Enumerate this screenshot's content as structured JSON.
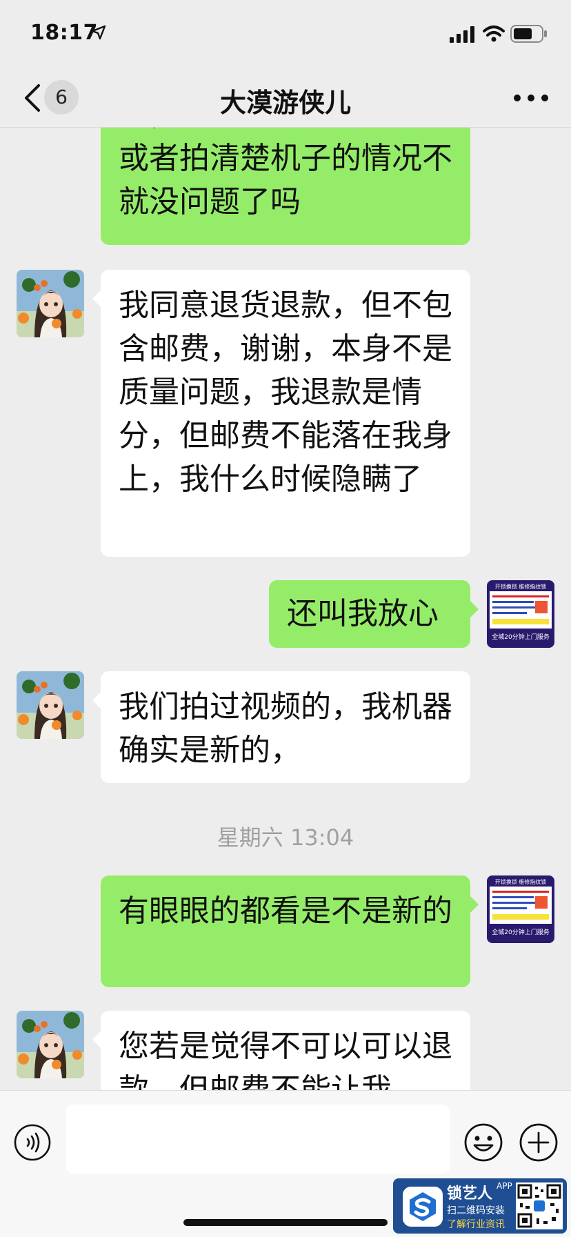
{
  "status_bar": {
    "time": "18:17"
  },
  "nav": {
    "title": "大漠游侠儿",
    "unread_count": "6"
  },
  "messages": [
    {
      "side": "right",
      "text": "况，如果没货前你说清楚或者拍清楚机子的情况不就没问题了吗"
    },
    {
      "side": "left",
      "text": "我同意退货退款，但不包含邮费，谢谢，本身不是质量问题，我退款是情分，但邮费不能落在我身上，我什么时候隐瞒了"
    },
    {
      "side": "right",
      "text": "还叫我放心"
    },
    {
      "side": "left",
      "text": "我们拍过视频的，我机器确实是新的，"
    },
    {
      "side": "right",
      "text": "有眼眼的都看是不是新的"
    },
    {
      "side": "left",
      "text": "您若是觉得不可以可以退款，但邮费不能让我"
    }
  ],
  "timestamp": "星期六 13:04",
  "self_avatar": {
    "top_text": "开锁换锁 维修指纹锁",
    "bottom_text": "全城20分钟上门服务"
  },
  "input": {
    "value": ""
  },
  "watermark": {
    "brand": "锁艺人",
    "app_tag": "APP",
    "line1": "扫二维码安装",
    "line2": "了解行业资讯"
  },
  "colors": {
    "sent_bubble": "#95ec69",
    "received_bubble": "#ffffff",
    "background": "#ededed"
  }
}
